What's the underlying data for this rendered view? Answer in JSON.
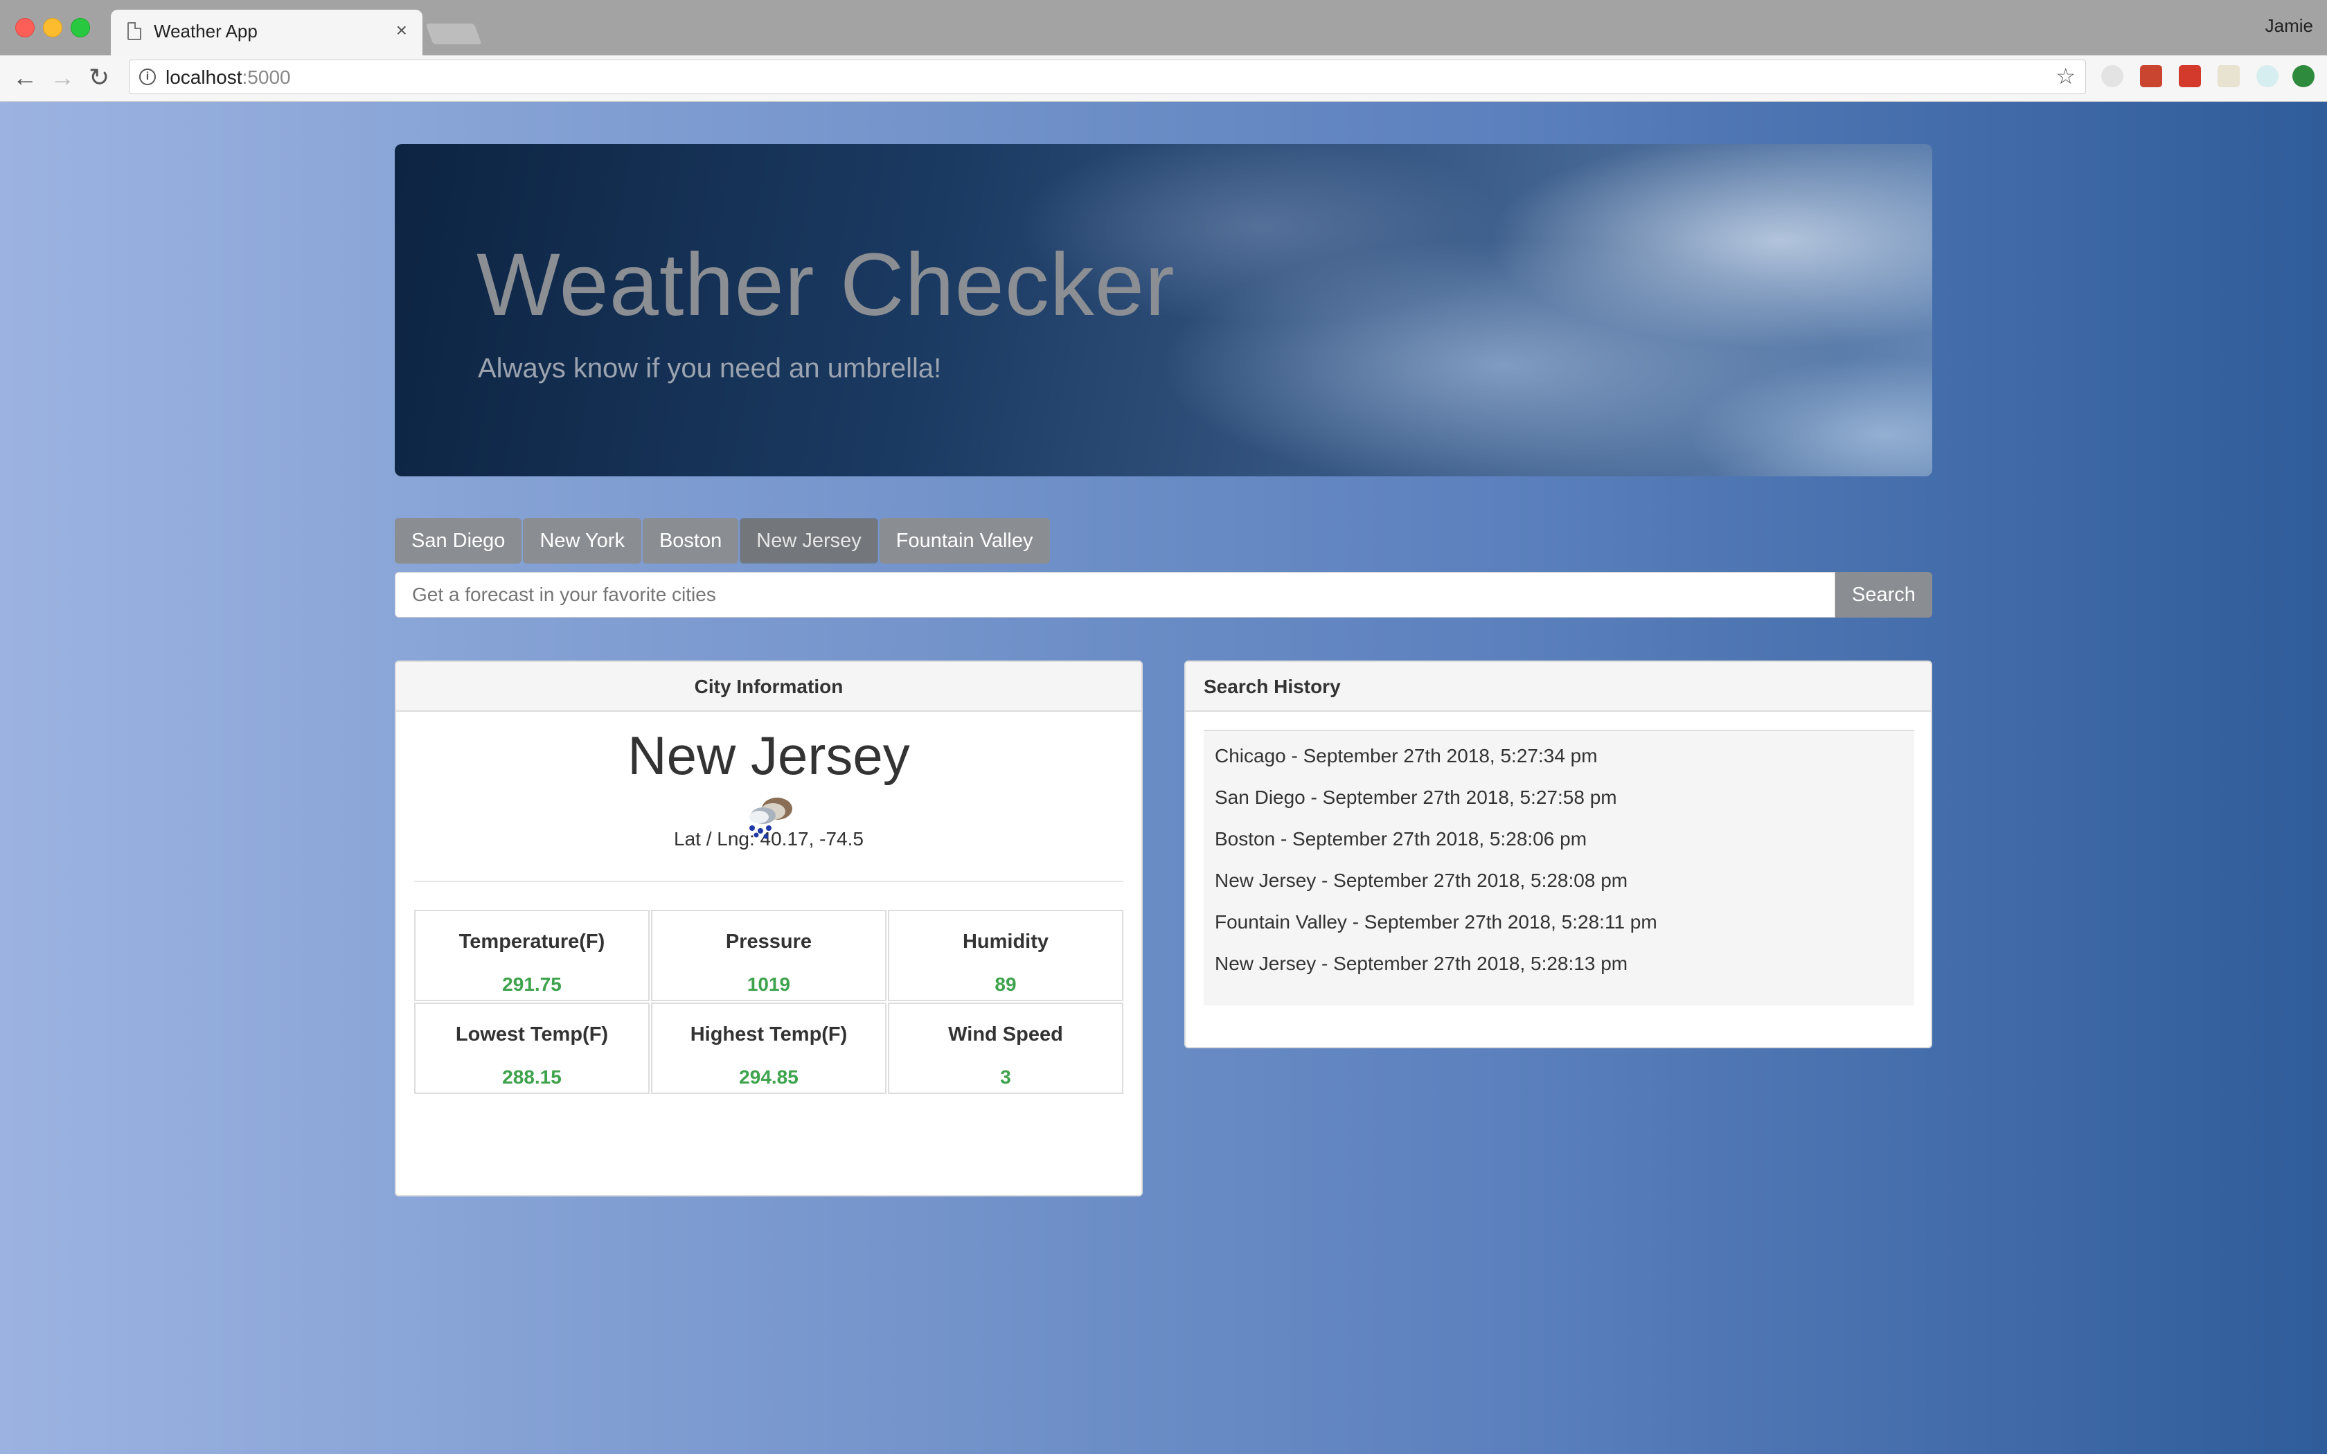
{
  "browser": {
    "tab_title": "Weather App",
    "tab_close": "×",
    "profile_name": "Jamie",
    "url_host": "localhost",
    "url_port": ":5000",
    "back": "←",
    "forward": "→",
    "reload": "↻",
    "info": "i",
    "bookmark": "☆"
  },
  "header": {
    "title": "Weather Checker",
    "subtitle": "Always know if you need an umbrella!"
  },
  "city_buttons": [
    {
      "label": "San Diego",
      "active": false
    },
    {
      "label": "New York",
      "active": false
    },
    {
      "label": "Boston",
      "active": false
    },
    {
      "label": "New Jersey",
      "active": true
    },
    {
      "label": "Fountain Valley",
      "active": false
    }
  ],
  "search": {
    "placeholder": "Get a forecast in your favorite cities",
    "value": "",
    "button_label": "Search"
  },
  "city_info": {
    "heading": "City Information",
    "city": "New Jersey",
    "latlng": "Lat / Lng: 40.17, -74.5",
    "icon": "rain-cloud-icon",
    "stats": [
      {
        "label": "Temperature(F)",
        "value": "291.75"
      },
      {
        "label": "Pressure",
        "value": "1019"
      },
      {
        "label": "Humidity",
        "value": "89"
      },
      {
        "label": "Lowest Temp(F)",
        "value": "288.15"
      },
      {
        "label": "Highest Temp(F)",
        "value": "294.85"
      },
      {
        "label": "Wind Speed",
        "value": "3"
      }
    ]
  },
  "history": {
    "heading": "Search History",
    "items": [
      "Chicago - September 27th 2018, 5:27:34 pm",
      "San Diego - September 27th 2018, 5:27:58 pm",
      "Boston - September 27th 2018, 5:28:06 pm",
      "New Jersey - September 27th 2018, 5:28:08 pm",
      "Fountain Valley - September 27th 2018, 5:28:11 pm",
      "New Jersey - September 27th 2018, 5:28:13 pm"
    ]
  },
  "colors": {
    "value_green": "#3fa34d",
    "button_gray": "#8a8d91",
    "title_gray": "#8b8e93"
  }
}
